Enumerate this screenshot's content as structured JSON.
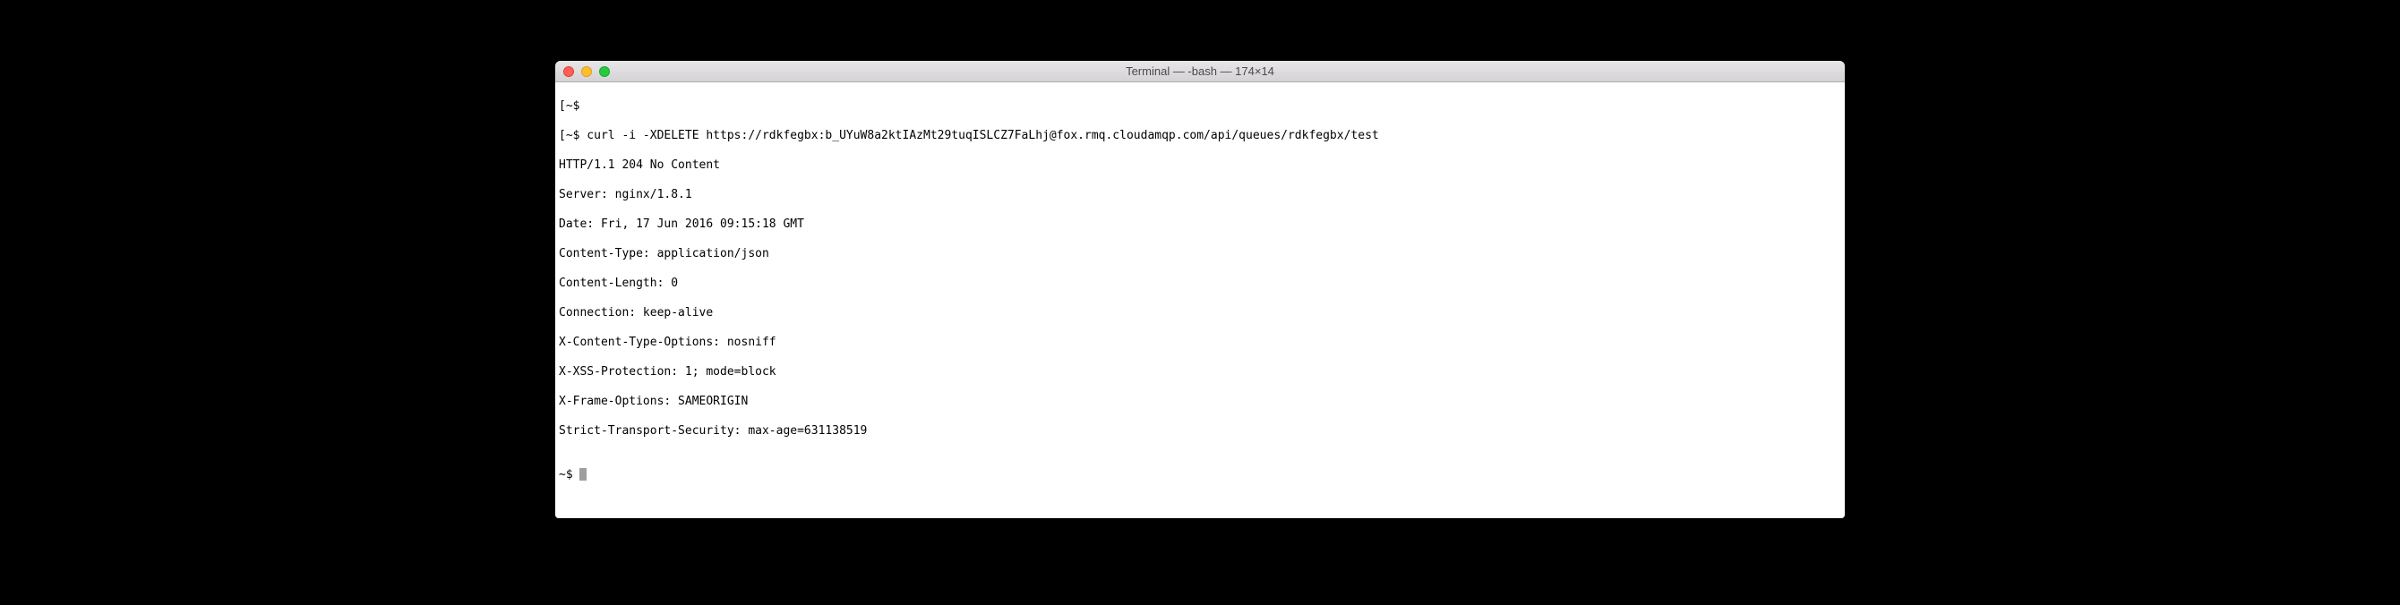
{
  "window": {
    "title": "Terminal — -bash — 174×14"
  },
  "terminal": {
    "lines": [
      "[~$ ",
      "[~$ curl -i -XDELETE https://rdkfegbx:b_UYuW8a2ktIAzMt29tuqISLCZ7FaLhj@fox.rmq.cloudamqp.com/api/queues/rdkfegbx/test",
      "HTTP/1.1 204 No Content",
      "Server: nginx/1.8.1",
      "Date: Fri, 17 Jun 2016 09:15:18 GMT",
      "Content-Type: application/json",
      "Content-Length: 0",
      "Connection: keep-alive",
      "X-Content-Type-Options: nosniff",
      "X-XSS-Protection: 1; mode=block",
      "X-Frame-Options: SAMEORIGIN",
      "Strict-Transport-Security: max-age=631138519",
      ""
    ],
    "prompt": "~$ "
  }
}
